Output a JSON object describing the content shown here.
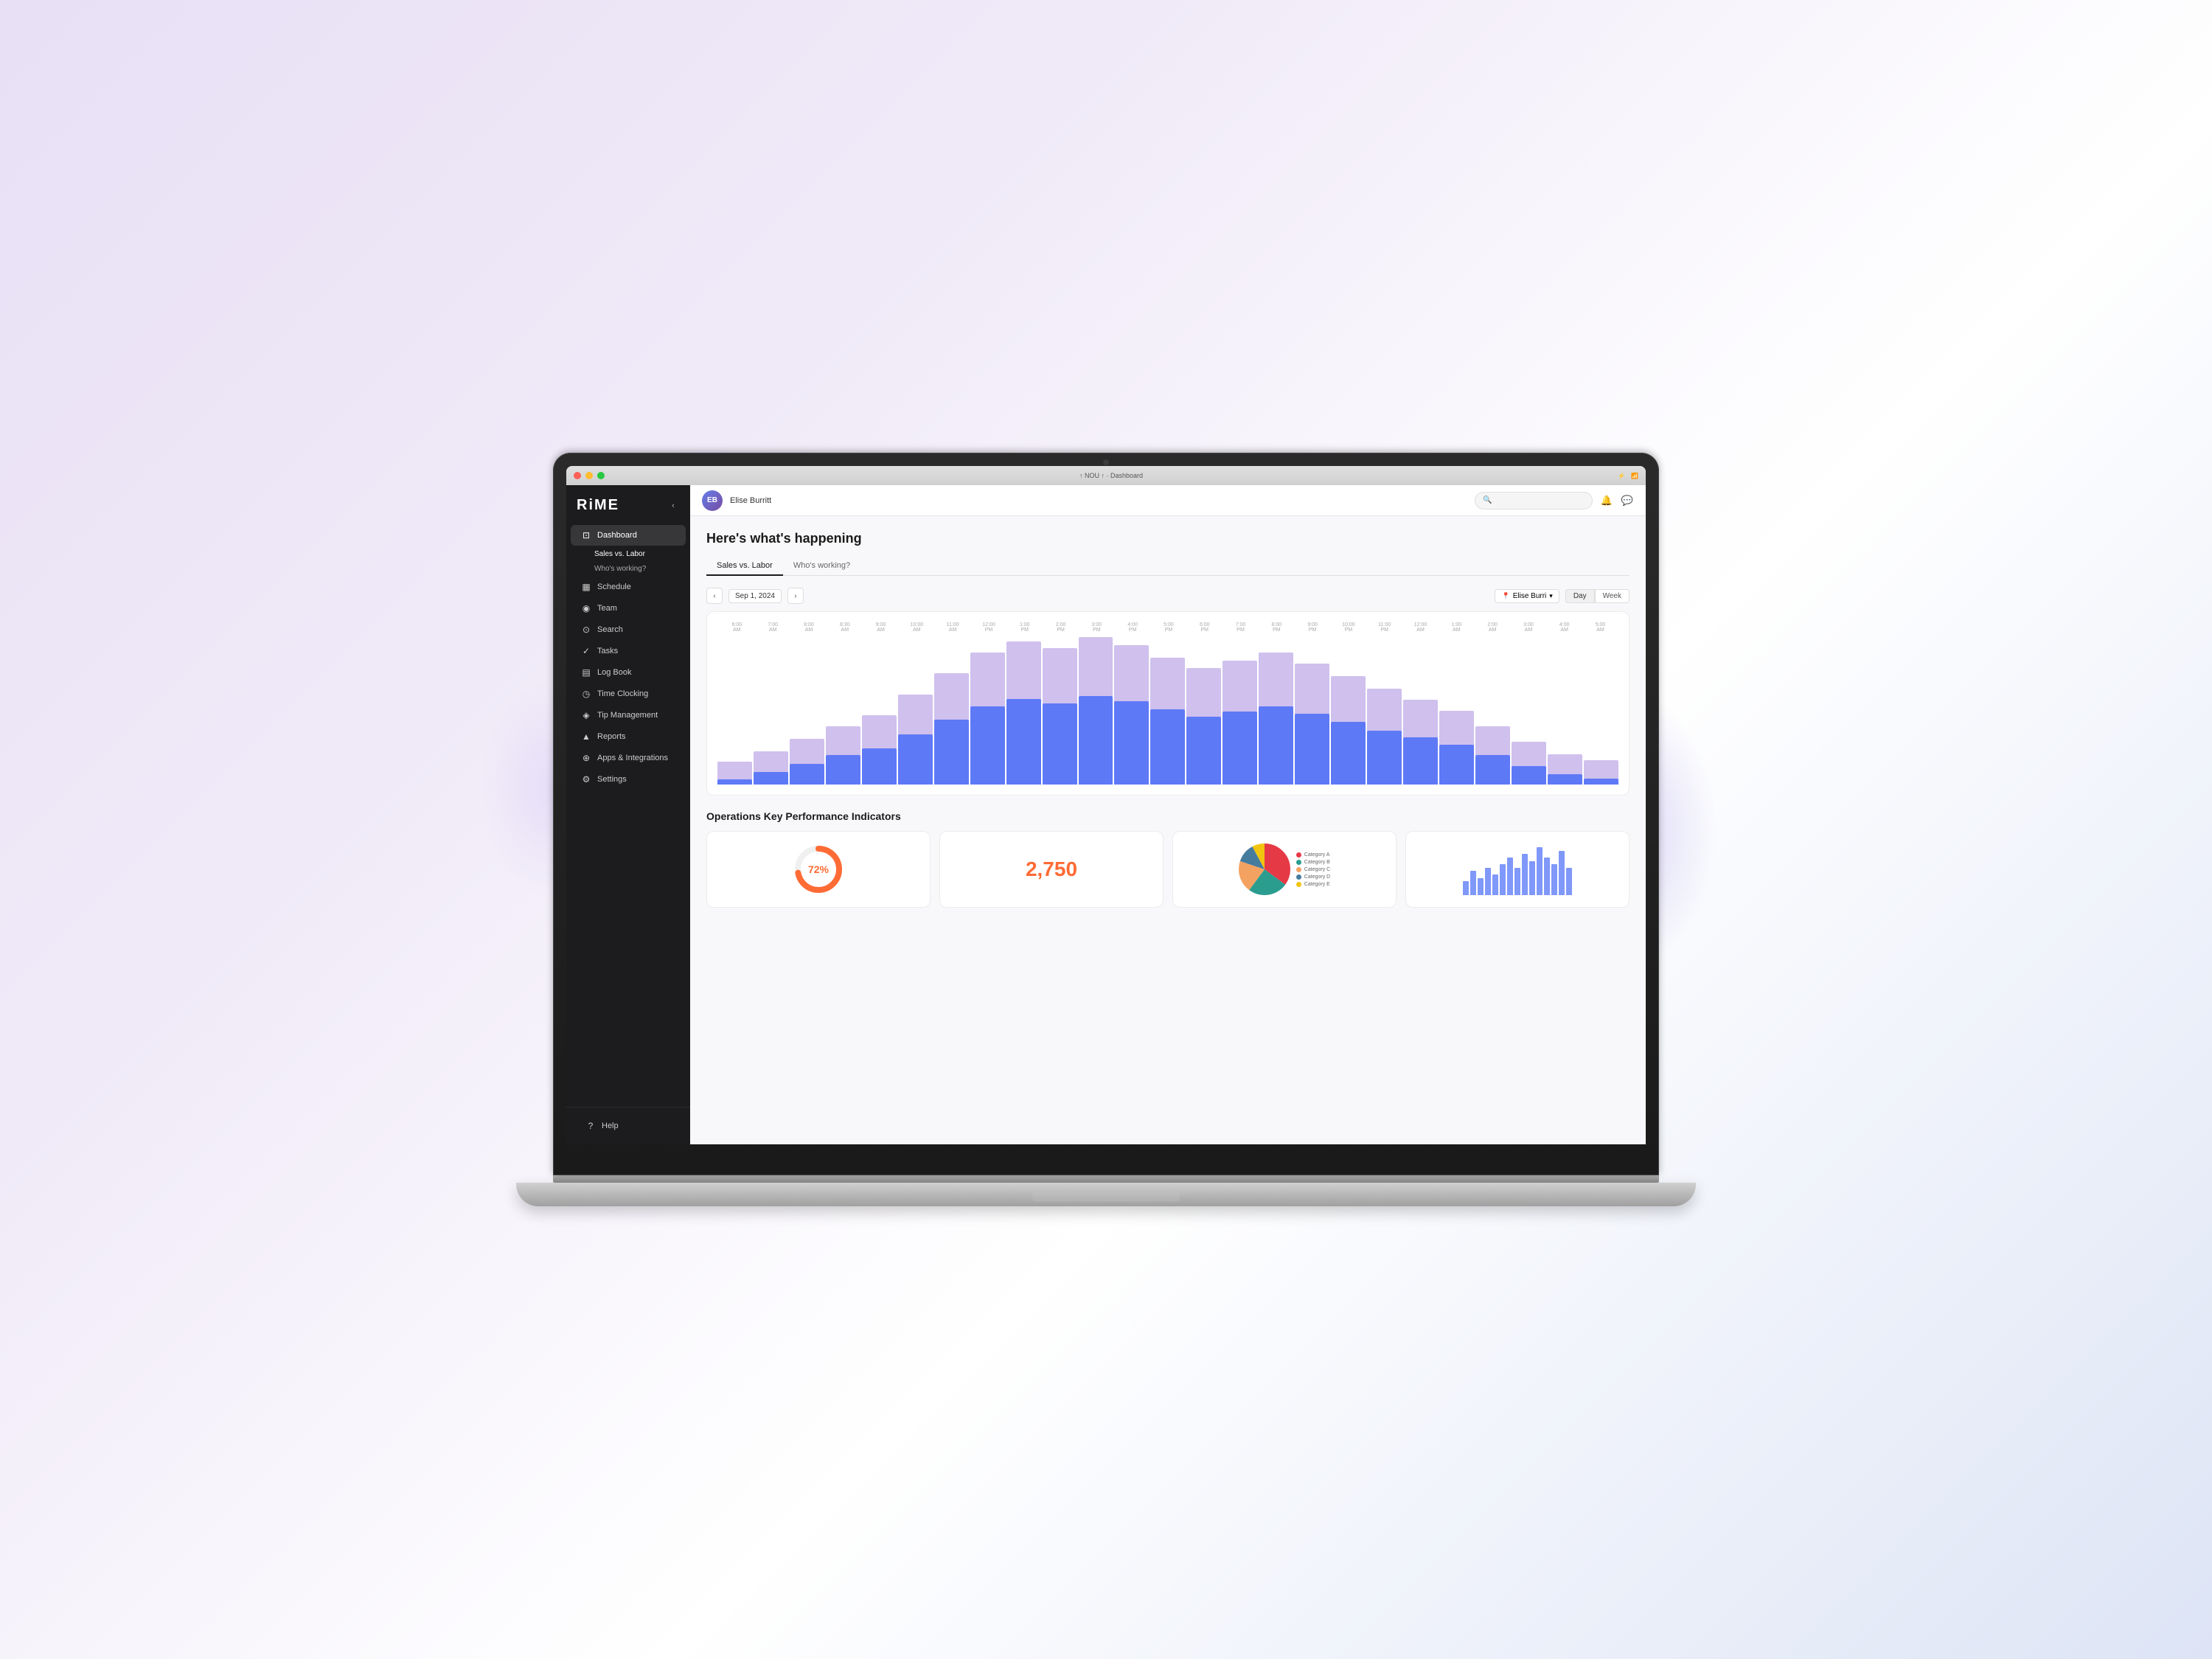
{
  "app": {
    "name": "RiME",
    "title": "NOU ↑ · Dashboard",
    "camera": "●"
  },
  "macos": {
    "traffic_lights": [
      "close",
      "minimize",
      "maximize"
    ],
    "title": "↑ NOU ↑ · Dashboard"
  },
  "sidebar": {
    "logo": "RiME",
    "collapse_icon": "‹",
    "nav": [
      {
        "id": "dashboard",
        "label": "Dashboard",
        "icon": "⊡",
        "active": true
      },
      {
        "id": "schedule",
        "label": "Schedule",
        "icon": "📅"
      },
      {
        "id": "team",
        "label": "Team",
        "icon": "👥"
      },
      {
        "id": "search",
        "label": "Search",
        "icon": "🔍"
      },
      {
        "id": "tasks",
        "label": "Tasks",
        "icon": "✓"
      },
      {
        "id": "logbook",
        "label": "Log Book",
        "icon": "📖"
      },
      {
        "id": "timeclocking",
        "label": "Time Clocking",
        "icon": "⏱"
      },
      {
        "id": "tipmanagement",
        "label": "Tip Management",
        "icon": "💡"
      },
      {
        "id": "reports",
        "label": "Reports",
        "icon": "📊"
      },
      {
        "id": "apps",
        "label": "Apps & Integrations",
        "icon": "⚙"
      },
      {
        "id": "settings",
        "label": "Settings",
        "icon": "⚙"
      }
    ],
    "sub_nav": [
      {
        "id": "sales-vs-labor",
        "label": "Sales vs. Labor",
        "active": true
      },
      {
        "id": "whos-working",
        "label": "Who's working?"
      }
    ],
    "help": "Help"
  },
  "header": {
    "user_name": "Elise Burritt",
    "user_initials": "EB",
    "search_placeholder": "Search",
    "notification_icon": "bell",
    "message_icon": "message"
  },
  "dashboard": {
    "title": "Here's what's happening",
    "tabs": [
      {
        "id": "sales-vs-labor",
        "label": "Sales vs. Labor",
        "active": true
      },
      {
        "id": "whos-working",
        "label": "Who's working?"
      }
    ],
    "chart": {
      "prev_btn": "‹",
      "next_btn": "›",
      "date": "Sep 1, 2024",
      "user_filter": "Elise Burri",
      "view_day": "Day",
      "view_week": "Week",
      "time_labels": [
        "6:00 AM",
        "7:00 AM",
        "8:00 AM",
        "8:30 AM",
        "9:00 AM",
        "10:00 AM",
        "11:00 AM",
        "12:00 PM",
        "1:00 PM",
        "2:00 PM",
        "3:00 PM",
        "4:00 PM",
        "5:00 PM",
        "6:00 PM",
        "7:00 PM",
        "8:00 PM",
        "9:00 PM",
        "10:00 PM",
        "11:00 PM",
        "12:00 AM",
        "1:00 AM",
        "2:00 AM",
        "3:00 AM",
        "4:00 AM",
        "5:00 AM"
      ],
      "bars": [
        5,
        12,
        20,
        28,
        35,
        48,
        62,
        75,
        82,
        78,
        85,
        80,
        72,
        65,
        70,
        75,
        68,
        60,
        52,
        45,
        38,
        28,
        18,
        10,
        6
      ]
    },
    "kpi": {
      "title": "Operations Key Performance Indicators",
      "cards": [
        {
          "id": "donut",
          "type": "donut",
          "value": "72%",
          "pct": 72
        },
        {
          "id": "number",
          "type": "number",
          "value": "2,750"
        },
        {
          "id": "pie",
          "type": "pie"
        },
        {
          "id": "bars",
          "type": "bars"
        }
      ]
    }
  },
  "pie_data": [
    {
      "label": "Category A",
      "color": "#e63946",
      "pct": 35
    },
    {
      "label": "Category B",
      "color": "#2a9d8f",
      "pct": 25
    },
    {
      "label": "Category C",
      "color": "#f4a261",
      "pct": 20
    },
    {
      "label": "Category D",
      "color": "#457b9d",
      "pct": 12
    },
    {
      "label": "Category E",
      "color": "#f1c40f",
      "pct": 8
    }
  ],
  "mini_bars_data": [
    4,
    7,
    5,
    8,
    6,
    9,
    11,
    8,
    12,
    10,
    14,
    11,
    9,
    13,
    8
  ],
  "colors": {
    "sidebar_bg": "#1c1c1e",
    "accent_blue": "#4a6cf7",
    "accent_orange": "#ff6b35",
    "bar_purple": "rgba(160,130,220,0.5)"
  }
}
